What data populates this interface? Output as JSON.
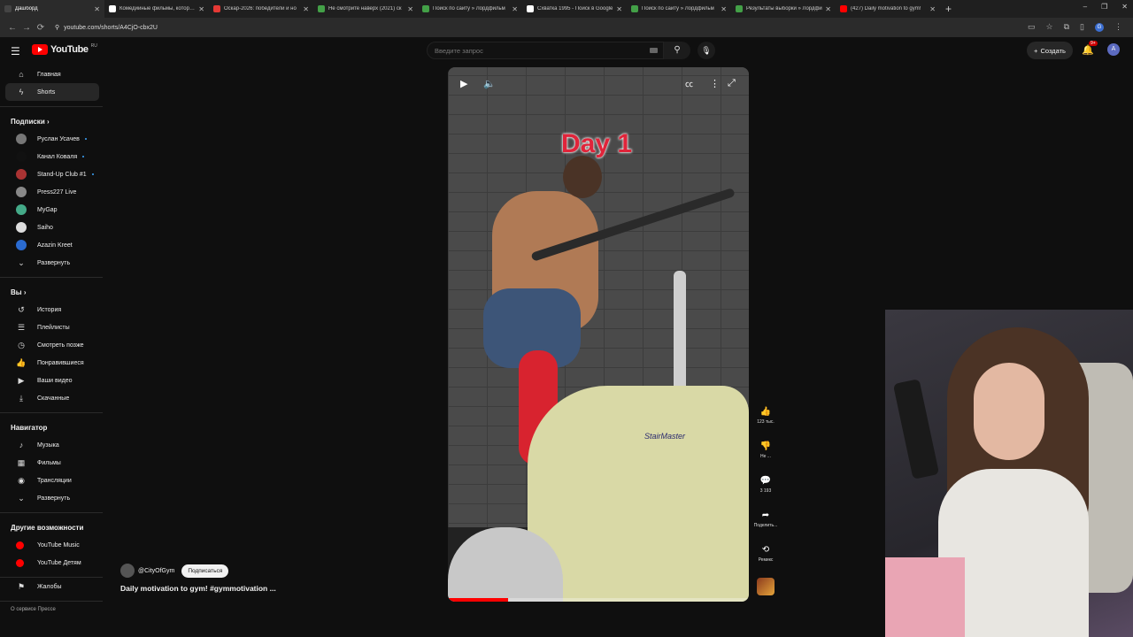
{
  "browser": {
    "tabs": [
      {
        "title": "Дашборд",
        "color": "#444",
        "active": true
      },
      {
        "title": "Комедийные фильмы, которые",
        "color": "#ffffff"
      },
      {
        "title": "Оскар-2026: победители и но",
        "color": "#e53935"
      },
      {
        "title": "Не смотрите наверх (2021) ск",
        "color": "#43a047"
      },
      {
        "title": "Поиск по сайту » Лордфильм",
        "color": "#43a047"
      },
      {
        "title": "Схватка 1995 - Поиск в Google",
        "color": "#ffffff"
      },
      {
        "title": "Поиск по сайту » Лордфильм",
        "color": "#43a047"
      },
      {
        "title": "Результаты выборки » Лордфи",
        "color": "#43a047"
      },
      {
        "title": "(427) Daily motivation to gym!",
        "color": "#ff0000"
      }
    ],
    "new_tab": "+",
    "window_controls": [
      "–",
      "❐",
      "✕"
    ],
    "url": "youtube.com/shorts/A4CjO-cbx2U"
  },
  "youtube": {
    "logo_text": "YouTube",
    "logo_sup": "RU",
    "search_placeholder": "Введите запрос",
    "create_label": "Создать",
    "notif_badge": "9+",
    "avatar_letter": "A"
  },
  "sidebar": {
    "main": [
      {
        "label": "Главная",
        "icon": "home-icon",
        "glyph": "⌂"
      },
      {
        "label": "Shorts",
        "icon": "shorts-icon",
        "glyph": "ϟ",
        "active": true
      }
    ],
    "subs_heading": "Подписки  ›",
    "subs": [
      {
        "label": "Руслан Усачев",
        "color": "#777",
        "dot": true
      },
      {
        "label": "Канал Коваля",
        "color": "#111",
        "dot": true
      },
      {
        "label": "Stand-Up Club #1",
        "color": "#a33",
        "dot": true
      },
      {
        "label": "Press227 Live",
        "color": "#888",
        "dot": false
      },
      {
        "label": "MyGap",
        "color": "#4a8",
        "dot": false
      },
      {
        "label": "Saiho",
        "color": "#ddd",
        "dot": false
      },
      {
        "label": "Azazin Kreet",
        "color": "#2a6bd1",
        "dot": false
      }
    ],
    "expand_label": "Развернуть",
    "you_heading": "Вы  ›",
    "you": [
      {
        "label": "История",
        "glyph": "↺"
      },
      {
        "label": "Плейлисты",
        "glyph": "☰"
      },
      {
        "label": "Смотреть позже",
        "glyph": "◷"
      },
      {
        "label": "Понравившиеся",
        "glyph": "👍"
      },
      {
        "label": "Ваши видео",
        "glyph": "▶"
      },
      {
        "label": "Скачанные",
        "glyph": "⤓"
      }
    ],
    "nav_heading": "Навигатор",
    "nav": [
      {
        "label": "Музыка",
        "glyph": "♪"
      },
      {
        "label": "Фильмы",
        "glyph": "▦"
      },
      {
        "label": "Трансляции",
        "glyph": "◉"
      }
    ],
    "nav_expand": "Развернуть",
    "more_heading": "Другие возможности",
    "more": [
      {
        "label": "YouTube Music",
        "color": "#ff0000"
      },
      {
        "label": "YouTube Детям",
        "color": "#ff0000"
      }
    ],
    "report_label": "Жалобы",
    "footer": "О сервисе  Прессе"
  },
  "video": {
    "overlay_text": "Day 1",
    "brand_text": "StairMaster",
    "progress": 0.2
  },
  "actions": {
    "like_count": "123 тыс.",
    "dislike_label": "Не ...",
    "comments_count": "3 193",
    "share_label": "Поделить...",
    "remix_label": "Ремикс"
  },
  "info": {
    "channel": "@CityOfGym",
    "subscribe_label": "Подписаться",
    "title": "Daily motivation to gym! #gymmotivation ..."
  }
}
